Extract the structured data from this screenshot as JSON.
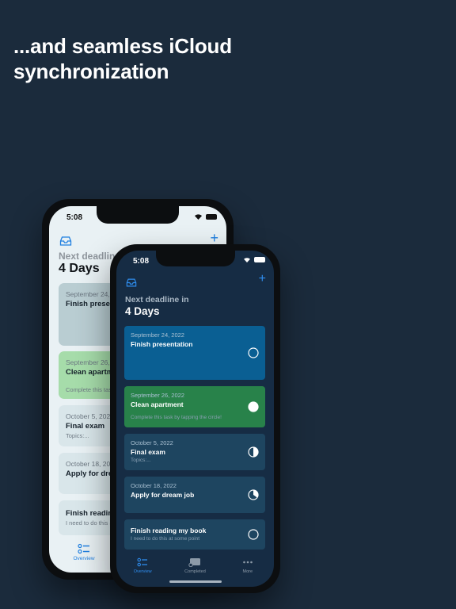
{
  "headline": "...and seamless iCloud synchronization",
  "back_phone": {
    "status_time": "5:08",
    "next_deadline_label": "Next deadline in",
    "days_label": "4 Days",
    "cards": [
      {
        "date": "September 24, 2022",
        "title": "Finish presentation",
        "subtitle": "",
        "color": "#b9cdd2"
      },
      {
        "date": "September 26, 2022",
        "title": "Clean apartment",
        "subtitle": "Complete this task by tapping the circle!",
        "color": "#a6dcaa"
      },
      {
        "date": "October 5, 2022",
        "title": "Final exam",
        "subtitle": "Topics:...",
        "color": "#d9e6ea"
      },
      {
        "date": "October 18, 2022",
        "title": "Apply for dream job",
        "subtitle": "",
        "color": "#d9e6ea"
      },
      {
        "date": "",
        "title": "Finish reading my book",
        "subtitle": "I need to do this at some point",
        "color": "#d9e6ea"
      }
    ],
    "tab_overview": "Overview"
  },
  "front_phone": {
    "status_time": "5:08",
    "next_deadline_label": "Next deadline in",
    "days_label": "4 Days",
    "cards": [
      {
        "date": "September 24, 2022",
        "title": "Finish presentation",
        "subtitle": "",
        "color": "#0a5f93",
        "progress": 0
      },
      {
        "date": "September 26, 2022",
        "title": "Clean apartment",
        "subtitle": "Complete this task by tapping the circle!",
        "color": "#28824a",
        "progress": 1
      },
      {
        "date": "October 5, 2022",
        "title": "Final exam",
        "subtitle": "Topics:...",
        "color": "#1e4560",
        "progress": 0.5
      },
      {
        "date": "October 18, 2022",
        "title": "Apply for dream job",
        "subtitle": "",
        "color": "#1e4560",
        "progress": 0.35
      },
      {
        "date": "",
        "title": "Finish reading my book",
        "subtitle": "I need to do this at some point",
        "color": "#1e4560",
        "progress": 0
      }
    ],
    "tabs": {
      "overview": "Overview",
      "completed": "Completed",
      "more": "More"
    }
  },
  "accent_color": "#2f8ef0"
}
